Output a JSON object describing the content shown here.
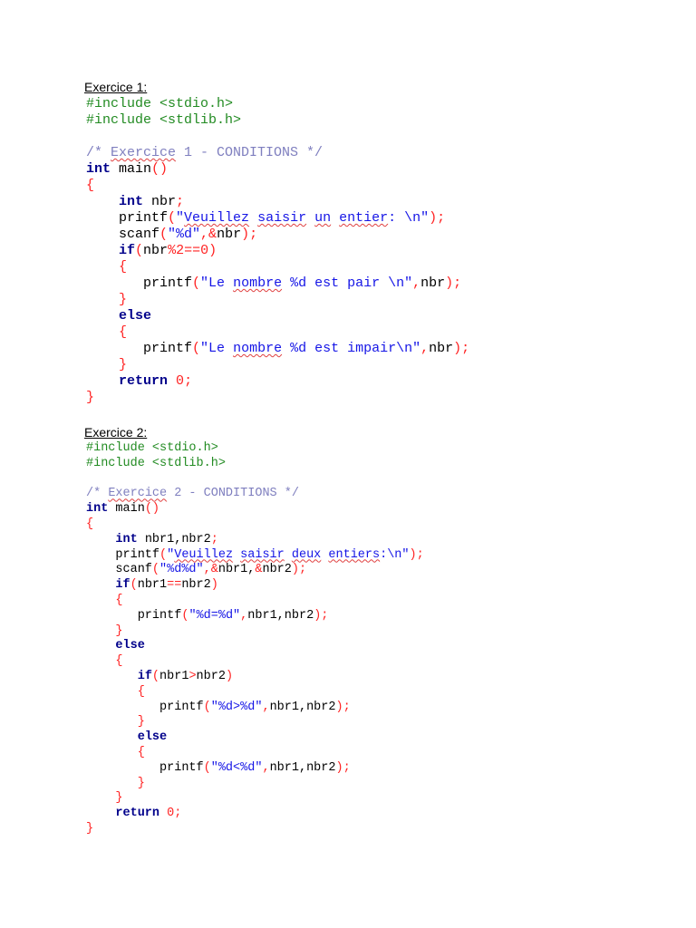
{
  "exercises": [
    {
      "heading": "Exercice 1:",
      "lines": [
        [
          [
            "pp",
            "#include <stdio.h>"
          ]
        ],
        [
          [
            "pp",
            "#include <stdlib.h>"
          ]
        ],
        [],
        [
          [
            "cm",
            "/* "
          ],
          [
            "cm sq",
            "Exercice"
          ],
          [
            "cm",
            " 1 - CONDITIONS */"
          ]
        ],
        [
          [
            "kw",
            "int"
          ],
          [
            "pl",
            " main"
          ],
          [
            "op",
            "()"
          ]
        ],
        [
          [
            "op",
            "{"
          ]
        ],
        [
          [
            "pl",
            "    "
          ],
          [
            "kw",
            "int"
          ],
          [
            "pl",
            " nbr"
          ],
          [
            "op",
            ";"
          ]
        ],
        [
          [
            "pl",
            "    printf"
          ],
          [
            "op",
            "("
          ],
          [
            "str",
            "\""
          ],
          [
            "str sq",
            "Veuillez"
          ],
          [
            "str",
            " "
          ],
          [
            "str sq",
            "saisir"
          ],
          [
            "str",
            " "
          ],
          [
            "str sq",
            "un"
          ],
          [
            "str",
            " "
          ],
          [
            "str sq",
            "entier"
          ],
          [
            "str",
            ": \\n\""
          ],
          [
            "op",
            ");"
          ]
        ],
        [
          [
            "pl",
            "    scanf"
          ],
          [
            "op",
            "("
          ],
          [
            "str",
            "\"%d\""
          ],
          [
            "op",
            ",&"
          ],
          [
            "pl",
            "nbr"
          ],
          [
            "op",
            ");"
          ]
        ],
        [
          [
            "pl",
            "    "
          ],
          [
            "kw",
            "if"
          ],
          [
            "op",
            "("
          ],
          [
            "pl",
            "nbr"
          ],
          [
            "num",
            "%2==0"
          ],
          [
            "op",
            ")"
          ]
        ],
        [
          [
            "pl",
            "    "
          ],
          [
            "op",
            "{"
          ]
        ],
        [
          [
            "pl",
            "       printf"
          ],
          [
            "op",
            "("
          ],
          [
            "str",
            "\"Le "
          ],
          [
            "str sq",
            "nombre"
          ],
          [
            "str",
            " %d est pair \\n\""
          ],
          [
            "op",
            ","
          ],
          [
            "pl",
            "nbr"
          ],
          [
            "op",
            ");"
          ]
        ],
        [
          [
            "pl",
            "    "
          ],
          [
            "op",
            "}"
          ]
        ],
        [
          [
            "pl",
            "    "
          ],
          [
            "kw",
            "else"
          ]
        ],
        [
          [
            "pl",
            "    "
          ],
          [
            "op",
            "{"
          ]
        ],
        [
          [
            "pl",
            "       printf"
          ],
          [
            "op",
            "("
          ],
          [
            "str",
            "\"Le "
          ],
          [
            "str sq",
            "nombre"
          ],
          [
            "str",
            " %d est impair\\n\""
          ],
          [
            "op",
            ","
          ],
          [
            "pl",
            "nbr"
          ],
          [
            "op",
            ");"
          ]
        ],
        [
          [
            "pl",
            "    "
          ],
          [
            "op",
            "}"
          ]
        ],
        [
          [
            "pl",
            "    "
          ],
          [
            "kw",
            "return"
          ],
          [
            "pl",
            " "
          ],
          [
            "num",
            "0"
          ],
          [
            "op",
            ";"
          ]
        ],
        [
          [
            "op",
            "}"
          ]
        ]
      ]
    },
    {
      "heading": "Exercice 2:",
      "lines": [
        [
          [
            "pp",
            "#include <stdio.h>"
          ]
        ],
        [
          [
            "pp",
            "#include <stdlib.h>"
          ]
        ],
        [],
        [
          [
            "cm",
            "/* "
          ],
          [
            "cm sq",
            "Exercice"
          ],
          [
            "cm",
            " 2 - CONDITIONS */"
          ]
        ],
        [
          [
            "kw",
            "int"
          ],
          [
            "pl",
            " main"
          ],
          [
            "op",
            "()"
          ]
        ],
        [
          [
            "op",
            "{"
          ]
        ],
        [
          [
            "pl",
            "    "
          ],
          [
            "kw",
            "int"
          ],
          [
            "pl",
            " nbr1,nbr2"
          ],
          [
            "op",
            ";"
          ]
        ],
        [
          [
            "pl",
            "    printf"
          ],
          [
            "op",
            "("
          ],
          [
            "str",
            "\""
          ],
          [
            "str sq",
            "Veuillez"
          ],
          [
            "str",
            " "
          ],
          [
            "str sq",
            "saisir"
          ],
          [
            "str",
            " "
          ],
          [
            "str sq",
            "deux"
          ],
          [
            "str",
            " "
          ],
          [
            "str sq",
            "entiers"
          ],
          [
            "str",
            ":\\n\""
          ],
          [
            "op",
            ");"
          ]
        ],
        [
          [
            "pl",
            "    scanf"
          ],
          [
            "op",
            "("
          ],
          [
            "str",
            "\"%d%d\""
          ],
          [
            "op",
            ",&"
          ],
          [
            "pl",
            "nbr1,"
          ],
          [
            "op",
            "&"
          ],
          [
            "pl",
            "nbr2"
          ],
          [
            "op",
            ");"
          ]
        ],
        [
          [
            "pl",
            "    "
          ],
          [
            "kw",
            "if"
          ],
          [
            "op",
            "("
          ],
          [
            "pl",
            "nbr1"
          ],
          [
            "op",
            "=="
          ],
          [
            "pl",
            "nbr2"
          ],
          [
            "op",
            ")"
          ]
        ],
        [
          [
            "pl",
            "    "
          ],
          [
            "op",
            "{"
          ]
        ],
        [
          [
            "pl",
            "       printf"
          ],
          [
            "op",
            "("
          ],
          [
            "str",
            "\"%d=%d\""
          ],
          [
            "op",
            ","
          ],
          [
            "pl",
            "nbr1,nbr2"
          ],
          [
            "op",
            ");"
          ]
        ],
        [
          [
            "pl",
            "    "
          ],
          [
            "op",
            "}"
          ]
        ],
        [
          [
            "pl",
            "    "
          ],
          [
            "kw",
            "else"
          ]
        ],
        [
          [
            "pl",
            "    "
          ],
          [
            "op",
            "{"
          ]
        ],
        [
          [
            "pl",
            "       "
          ],
          [
            "kw",
            "if"
          ],
          [
            "op",
            "("
          ],
          [
            "pl",
            "nbr1"
          ],
          [
            "op",
            ">"
          ],
          [
            "pl",
            "nbr2"
          ],
          [
            "op",
            ")"
          ]
        ],
        [
          [
            "pl",
            "       "
          ],
          [
            "op",
            "{"
          ]
        ],
        [
          [
            "pl",
            "          printf"
          ],
          [
            "op",
            "("
          ],
          [
            "str",
            "\"%d>%d\""
          ],
          [
            "op",
            ","
          ],
          [
            "pl",
            "nbr1,nbr2"
          ],
          [
            "op",
            ");"
          ]
        ],
        [
          [
            "pl",
            "       "
          ],
          [
            "op",
            "}"
          ]
        ],
        [
          [
            "pl",
            "       "
          ],
          [
            "kw",
            "else"
          ]
        ],
        [
          [
            "pl",
            "       "
          ],
          [
            "op",
            "{"
          ]
        ],
        [
          [
            "pl",
            "          printf"
          ],
          [
            "op",
            "("
          ],
          [
            "str",
            "\"%d<%d\""
          ],
          [
            "op",
            ","
          ],
          [
            "pl",
            "nbr1,nbr2"
          ],
          [
            "op",
            ");"
          ]
        ],
        [
          [
            "pl",
            "       "
          ],
          [
            "op",
            "}"
          ]
        ],
        [
          [
            "pl",
            "    "
          ],
          [
            "op",
            "}"
          ]
        ],
        [
          [
            "pl",
            "    "
          ],
          [
            "kw",
            "return"
          ],
          [
            "pl",
            " "
          ],
          [
            "num",
            "0"
          ],
          [
            "op",
            ";"
          ]
        ],
        [
          [
            "op",
            "}"
          ]
        ]
      ]
    }
  ]
}
